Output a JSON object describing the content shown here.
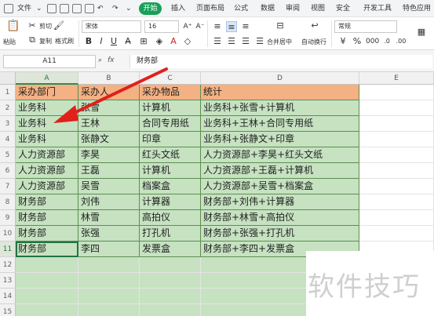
{
  "menubar": {
    "file": "文件",
    "start": "开始",
    "tabs": [
      "插入",
      "页面布局",
      "公式",
      "数据",
      "审阅",
      "视图",
      "安全",
      "开发工具",
      "特色应用"
    ]
  },
  "ribbon": {
    "paste": "粘贴",
    "cut": "剪切",
    "copy": "复制",
    "format_painter": "格式刷",
    "font_name": "宋体",
    "font_size": "16",
    "merge_center": "合并居中",
    "auto_wrap": "自动换行",
    "number_format": "常规",
    "bold": "B",
    "italic": "I",
    "underline": "U"
  },
  "formula_bar": {
    "name_box": "A11",
    "fx": "fx",
    "content": "财务部"
  },
  "columns": [
    "A",
    "B",
    "C",
    "D",
    "E"
  ],
  "rows": [
    "1",
    "2",
    "3",
    "4",
    "5",
    "6",
    "7",
    "8",
    "9",
    "10",
    "11",
    "12",
    "13",
    "14",
    "15"
  ],
  "table": {
    "header": [
      "采办部门",
      "采办人",
      "采办物品",
      "统计"
    ],
    "rows": [
      [
        "业务科",
        "张雪",
        "计算机",
        "业务科+张雪+计算机"
      ],
      [
        "业务科",
        "王林",
        "合同专用纸",
        "业务科+王林+合同专用纸"
      ],
      [
        "业务科",
        "张静文",
        "印章",
        "业务科+张静文+印章"
      ],
      [
        "人力资源部",
        "李昊",
        "红头文纸",
        "人力资源部+李昊+红头文纸"
      ],
      [
        "人力资源部",
        "王磊",
        "计算机",
        "人力资源部+王磊+计算机"
      ],
      [
        "人力资源部",
        "吴雪",
        "档案盒",
        "人力资源部+吴雪+档案盒"
      ],
      [
        "财务部",
        "刘伟",
        "计算器",
        "财务部+刘伟+计算器"
      ],
      [
        "财务部",
        "林雪",
        "高拍仪",
        "财务部+林雪+高拍仪"
      ],
      [
        "财务部",
        "张强",
        "打孔机",
        "财务部+张强+打孔机"
      ],
      [
        "财务部",
        "李四",
        "发票盒",
        "财务部+李四+发票盒"
      ]
    ]
  },
  "watermark": "软件技巧",
  "colors": {
    "header_fill": "#f4b183",
    "body_fill": "#c6e2c1",
    "accent": "#18a058",
    "arrow": "#e0201b"
  }
}
